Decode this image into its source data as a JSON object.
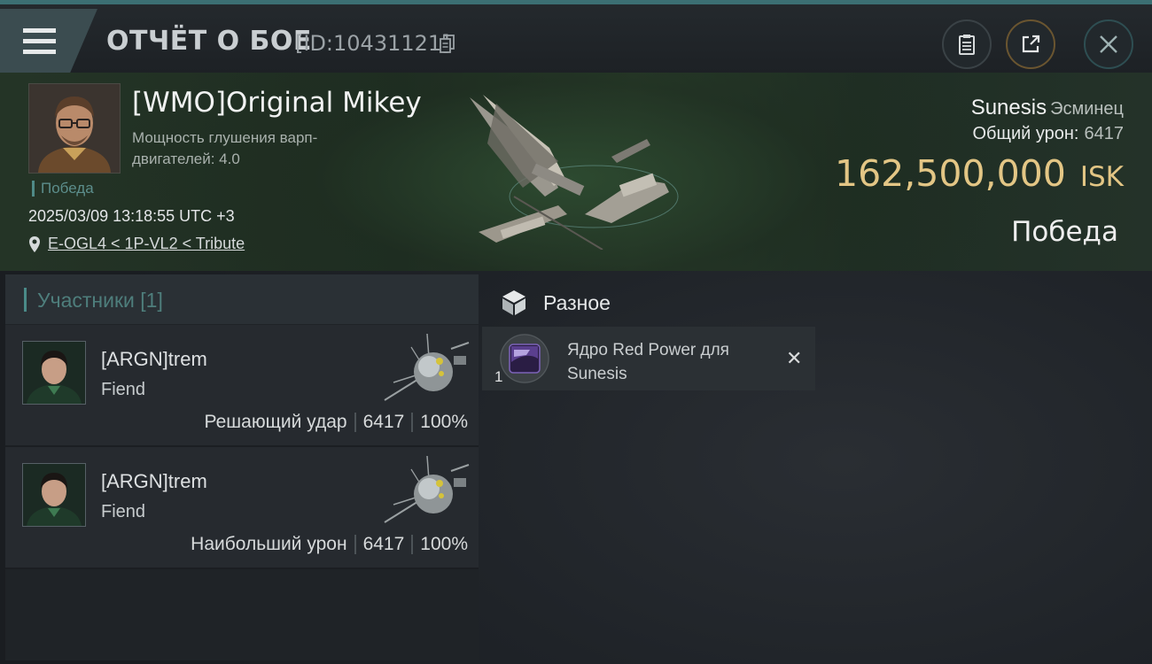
{
  "header": {
    "title": "ОТЧЁТ О БОЕ",
    "report_id": "[ID:10431121]"
  },
  "victim": {
    "name": "[WMO]Original Mikey",
    "stat_label": "Мощность глушения варп-двигателей: 4.0",
    "tag": "Победа",
    "datetime": "2025/03/09 13:18:55 UTC +3",
    "location": "E-OGL4 < 1P-VL2 < Tribute",
    "ship_name": "Sunesis",
    "ship_class": "Эсминец",
    "damage_label": "Общий урон:",
    "damage_value": "6417",
    "isk_value": "162,500,000",
    "isk_unit": "ISK",
    "result": "Победа"
  },
  "participants": {
    "title": "Участники [1]",
    "rows": [
      {
        "name": "[ARGN]trem",
        "ship": "Fiend",
        "role": "Решающий удар",
        "damage": "6417",
        "percent": "100%"
      },
      {
        "name": "[ARGN]trem",
        "ship": "Fiend",
        "role": "Наибольший урон",
        "damage": "6417",
        "percent": "100%"
      }
    ]
  },
  "misc": {
    "title": "Разное",
    "items": [
      {
        "qty": "1",
        "name": "Ядро Red Power для Sunesis"
      }
    ]
  },
  "colors": {
    "accent": "#4a8a88",
    "isk": "#e3c685"
  }
}
